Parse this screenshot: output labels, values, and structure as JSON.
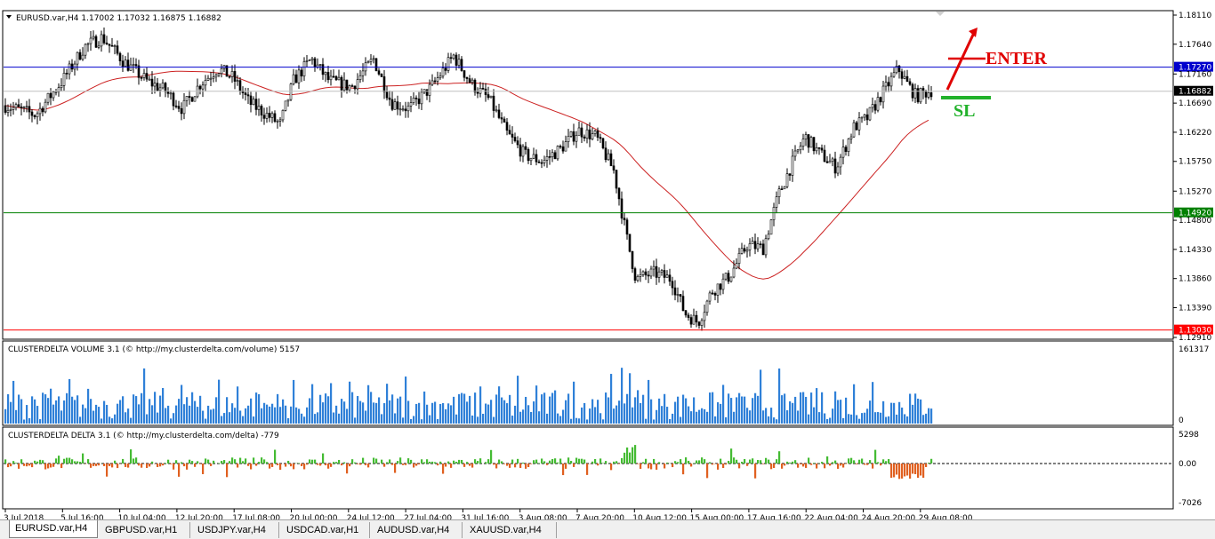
{
  "chart": {
    "title": "EURUSD.var,H4  1.17002 1.17032 1.16875 1.16882",
    "price_axis": [
      "1.18110",
      "1.17640",
      "1.17160",
      "1.16690",
      "1.16220",
      "1.15750",
      "1.15270",
      "1.14800",
      "1.14330",
      "1.13860",
      "1.13390",
      "1.12910"
    ],
    "levels": [
      {
        "value": "1.17270",
        "color": "#0000cd"
      },
      {
        "value": "1.16882",
        "color": "#000000"
      },
      {
        "value": "1.14920",
        "color": "#008000"
      },
      {
        "value": "1.13030",
        "color": "#ff0000"
      }
    ],
    "annotations": {
      "enter": "ENTER",
      "sl": "SL",
      "enter_color": "#e00000",
      "sl_color": "#22b22b"
    },
    "ma_color": "#cc2222"
  },
  "volume": {
    "title": "CLUSTERDELTA VOLUME 3.1 (© http://my.clusterdelta.com/volume) 5157",
    "axis_top": "161317",
    "axis_bottom": "0",
    "bar_color": "#2f80d8"
  },
  "delta": {
    "title": "CLUSTERDELTA DELTA 3.1 (© http://my.clusterdelta.com/delta) -779",
    "axis": [
      "5298",
      "0.00",
      "-7026"
    ],
    "pos_color": "#44bb33",
    "neg_color": "#e06020"
  },
  "time_axis": [
    "3 Jul 2018",
    "5 Jul 16:00",
    "10 Jul 04:00",
    "12 Jul 20:00",
    "17 Jul 08:00",
    "20 Jul 00:00",
    "24 Jul 12:00",
    "27 Jul 04:00",
    "31 Jul 16:00",
    "3 Aug 08:00",
    "7 Aug 20:00",
    "10 Aug 12:00",
    "15 Aug 00:00",
    "17 Aug 16:00",
    "22 Aug 04:00",
    "24 Aug 20:00",
    "29 Aug 08:00"
  ],
  "tabs": [
    "EURUSD.var,H4",
    "GBPUSD.var,H1",
    "USDJPY.var,H4",
    "USDCAD.var,H1",
    "AUDUSD.var,H4",
    "XAUUSD.var,H4"
  ],
  "active_tab": 0
}
